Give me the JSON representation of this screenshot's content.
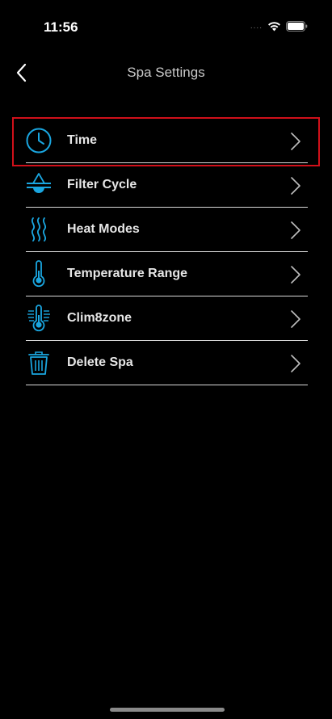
{
  "status_bar": {
    "time": "11:56",
    "signal": "....",
    "wifi_icon": "wifi-icon",
    "battery_icon": "battery-icon"
  },
  "nav": {
    "title": "Spa Settings",
    "back_icon": "chevron-left-icon"
  },
  "colors": {
    "accent": "#1aa6e0",
    "background": "#000000",
    "divider": "#d9d9d9",
    "highlight": "#d0101a"
  },
  "items": [
    {
      "label": "Time",
      "icon": "clock-icon"
    },
    {
      "label": "Filter Cycle",
      "icon": "filter-drop-icon"
    },
    {
      "label": "Heat Modes",
      "icon": "heat-waves-icon"
    },
    {
      "label": "Temperature Range",
      "icon": "thermometer-icon"
    },
    {
      "label": "Clim8zone",
      "icon": "clim8zone-thermometer-icon"
    },
    {
      "label": "Delete Spa",
      "icon": "trash-icon"
    }
  ]
}
